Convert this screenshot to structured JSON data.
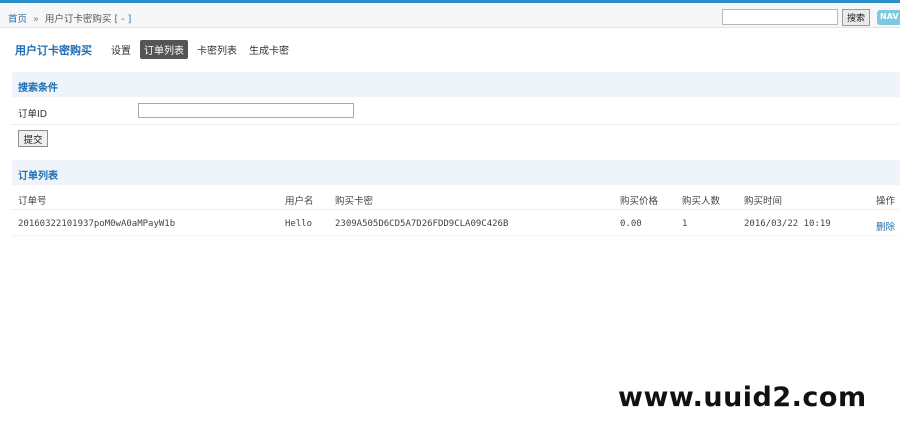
{
  "breadcrumb": {
    "home": "首页",
    "separator": "»",
    "current": "用户订卡密购买",
    "suffix": "[ - ]"
  },
  "search": {
    "value": "",
    "button_label": "搜索"
  },
  "nav_badge": "NAV",
  "module": {
    "title": "用户订卡密购买"
  },
  "subnav": [
    {
      "label": "设置",
      "active": false
    },
    {
      "label": "订单列表",
      "active": true
    },
    {
      "label": "卡密列表",
      "active": false
    },
    {
      "label": "生成卡密",
      "active": false
    }
  ],
  "search_section": {
    "title": "搜索条件"
  },
  "filter": {
    "order_id_label": "订单ID",
    "order_id_value": "",
    "submit_label": "提交"
  },
  "list_section": {
    "title": "订单列表"
  },
  "table": {
    "headers": [
      "订单号",
      "用户名",
      "购买卡密",
      "购买价格",
      "购买人数",
      "购买时间",
      "操作"
    ],
    "rows": [
      {
        "order_no": "20160322101937poM0wA0aMPayW1b",
        "username": "Hello",
        "card_key": "2309A505D6CD5A7D26FDD9CLA09C426B",
        "price": "0.00",
        "count": "1",
        "time": "2016/03/22 10:19",
        "action": "删除"
      }
    ]
  },
  "watermark": "www.uuid2.com"
}
